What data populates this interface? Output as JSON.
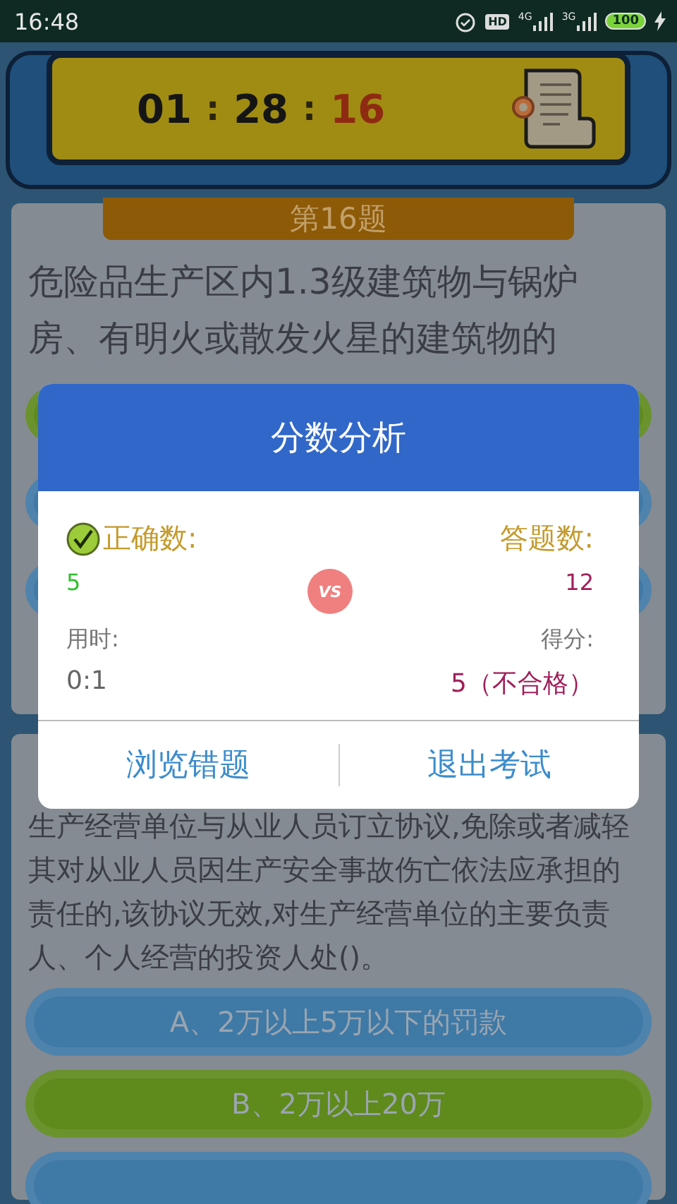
{
  "status_bar": {
    "time": "16:48",
    "hd_badge": "HD",
    "networks": [
      "4G",
      "3G"
    ],
    "battery": "100"
  },
  "timer": {
    "hours": "01",
    "minutes": "28",
    "seconds": "16",
    "separator": ":"
  },
  "questions": [
    {
      "number": "第16题",
      "text": "危险品生产区内1.3级建筑物与锅炉房、有明火或散发火星的建筑物的",
      "options": [
        {
          "color": "#5f8a1c"
        },
        {
          "color": "#3f79a6"
        },
        {
          "color": "#3f79a6"
        }
      ]
    },
    {
      "text": "生产经营单位与从业人员订立协议,免除或者减轻其对从业人员因生产安全事故伤亡依法应承担的责任的,该协议无效,对生产经营单位的主要负责人、个人经营的投资人处()。",
      "options": [
        {
          "label": "A、2万以上5万以下的罚款",
          "color": "#3f79a6"
        },
        {
          "label": "B、2万以上20万",
          "color": "#5f8a1c"
        },
        {
          "color": "#3f79a6"
        }
      ]
    }
  ],
  "dialog": {
    "title": "分数分析",
    "correct_label": "正确数:",
    "correct_value": "5",
    "versus": "VS",
    "answered_label": "答题数:",
    "answered_value": "12",
    "time_label": "用时:",
    "time_value": "0:1",
    "score_label": "得分:",
    "score_value": "5（不合格）",
    "buttons": [
      "浏览错题",
      "退出考试"
    ]
  }
}
